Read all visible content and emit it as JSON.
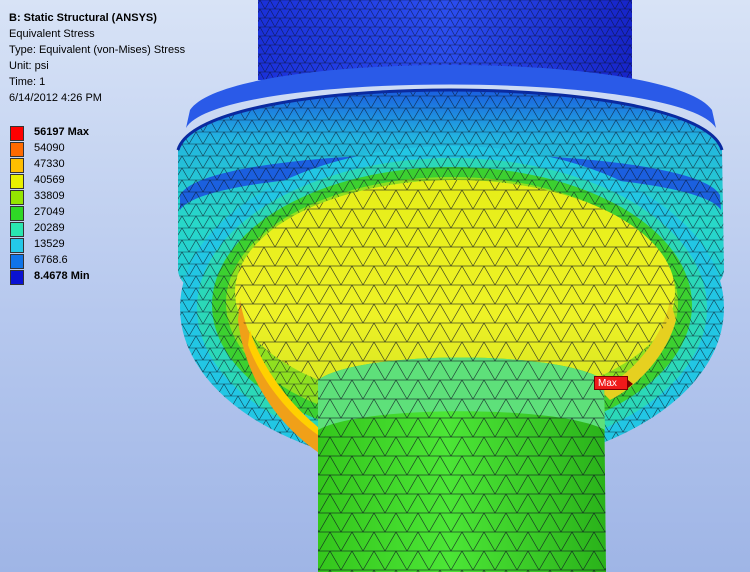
{
  "info": {
    "title": "B: Static Structural (ANSYS)",
    "result": "Equivalent Stress",
    "type": "Type: Equivalent (von-Mises) Stress",
    "unit": "Unit: psi",
    "time": "Time: 1",
    "date": "6/14/2012 4:26 PM"
  },
  "legend": [
    {
      "label": "56197 Max",
      "color": "#ff0000",
      "bold": true
    },
    {
      "label": "54090",
      "color": "#ff6a00",
      "bold": false
    },
    {
      "label": "47330",
      "color": "#ffbe00",
      "bold": false
    },
    {
      "label": "40569",
      "color": "#e8f000",
      "bold": false
    },
    {
      "label": "33809",
      "color": "#94e600",
      "bold": false
    },
    {
      "label": "27049",
      "color": "#2fd826",
      "bold": false
    },
    {
      "label": "20289",
      "color": "#2ae6b0",
      "bold": false
    },
    {
      "label": "13529",
      "color": "#24c8e8",
      "bold": false
    },
    {
      "label": "6768.6",
      "color": "#0f74e8",
      "bold": false
    },
    {
      "label": "8.4678 Min",
      "color": "#0a12d2",
      "bold": true
    }
  ],
  "probe": {
    "label": "Max"
  }
}
